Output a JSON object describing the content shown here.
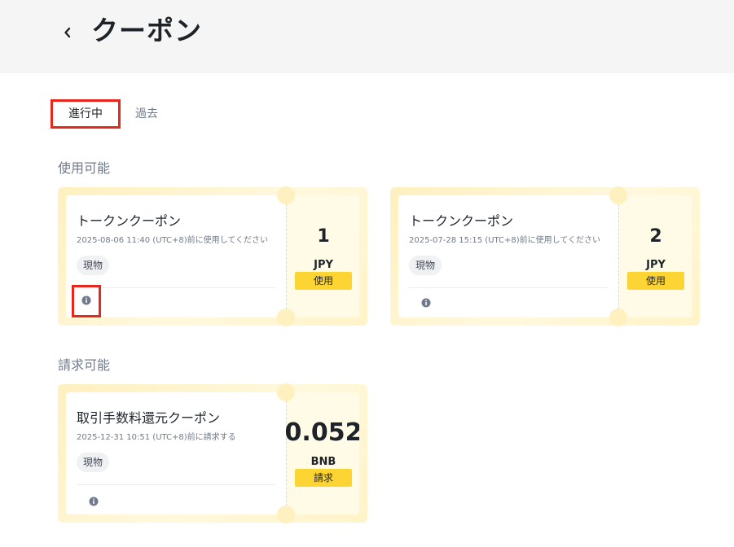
{
  "header": {
    "title": "クーポン",
    "back_icon": "chevron-left-icon"
  },
  "tabs": [
    {
      "label": "進行中",
      "active": true
    },
    {
      "label": "過去",
      "active": false
    }
  ],
  "sections": {
    "available": {
      "title": "使用可能",
      "coupons": [
        {
          "name": "トークンクーポン",
          "expiry": "2025-08-06 11:40 (UTC+8)前に使用してください",
          "tag": "現物",
          "amount": "1",
          "unit": "JPY",
          "action": "使用"
        },
        {
          "name": "トークンクーポン",
          "expiry": "2025-07-28 15:15 (UTC+8)前に使用してください",
          "tag": "現物",
          "amount": "2",
          "unit": "JPY",
          "action": "使用"
        }
      ]
    },
    "claimable": {
      "title": "請求可能",
      "coupons": [
        {
          "name": "取引手数料還元クーポン",
          "expiry": "2025-12-31 10:51 (UTC+8)前に請求する",
          "tag": "現物",
          "amount": "0.052",
          "unit": "BNB",
          "action": "請求"
        }
      ]
    }
  },
  "colors": {
    "accent": "#fcd535",
    "highlight": "#e8261b",
    "coupon_border": "#fff0c0"
  }
}
